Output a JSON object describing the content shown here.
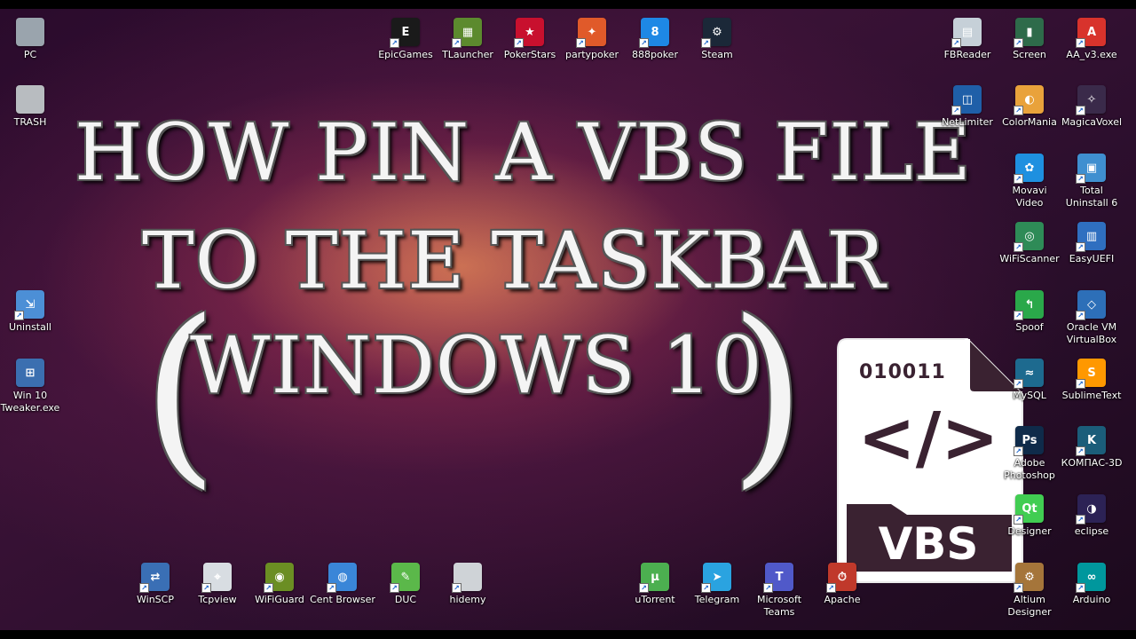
{
  "title": {
    "line1": "HOW PIN A VBS FILE",
    "line2": "TO THE TASKBAR",
    "line3": "WINDOWS 10",
    "paren_open": "(",
    "paren_close": ")"
  },
  "vbs_icon": {
    "binary": "010011",
    "code_symbol": "</>",
    "ext": "VBS"
  },
  "icons": [
    {
      "id": "pc",
      "label": "PC",
      "icon": "monitor-icon",
      "color": "#9aa4ad",
      "glyph": ""
    },
    {
      "id": "trash",
      "label": "TRASH",
      "icon": "recycle-bin-icon",
      "color": "#b8bcc0",
      "glyph": ""
    },
    {
      "id": "uninstall",
      "label": "Uninstall",
      "icon": "uninstall-icon",
      "color": "#4c8fd6",
      "glyph": "⇲"
    },
    {
      "id": "win10tweaker",
      "label": "Win 10\nTweaker.exe",
      "icon": "windows-logo-icon",
      "color": "#3b6fb0",
      "glyph": "⊞"
    },
    {
      "id": "epic",
      "label": "EpicGames",
      "icon": "epic-games-icon",
      "color": "#1a1a1a",
      "glyph": "E"
    },
    {
      "id": "tlauncher",
      "label": "TLauncher",
      "icon": "minecraft-block-icon",
      "color": "#5c8a2e",
      "glyph": "▦"
    },
    {
      "id": "pokerstars",
      "label": "PokerStars",
      "icon": "pokerstars-icon",
      "color": "#c8102e",
      "glyph": "★"
    },
    {
      "id": "partypoker",
      "label": "partypoker",
      "icon": "partypoker-icon",
      "color": "#e05a2a",
      "glyph": "✦"
    },
    {
      "id": "888poker",
      "label": "888poker",
      "icon": "888poker-icon",
      "color": "#1e88e5",
      "glyph": "8"
    },
    {
      "id": "steam",
      "label": "Steam",
      "icon": "steam-icon",
      "color": "#1b2838",
      "glyph": "⚙"
    },
    {
      "id": "fbreader",
      "label": "FBReader",
      "icon": "fbreader-icon",
      "color": "#c6d0d8",
      "glyph": "▤"
    },
    {
      "id": "screen",
      "label": "Screen",
      "icon": "screen-icon",
      "color": "#2e6b4a",
      "glyph": "▮"
    },
    {
      "id": "aa",
      "label": "AA_v3.exe",
      "icon": "ammyy-admin-icon",
      "color": "#d8332c",
      "glyph": "A"
    },
    {
      "id": "netlimiter",
      "label": "NetLimiter",
      "icon": "netlimiter-icon",
      "color": "#1f5fa8",
      "glyph": "◫"
    },
    {
      "id": "colormania",
      "label": "ColorMania",
      "icon": "color-wheel-icon",
      "color": "#e9a23b",
      "glyph": "◐"
    },
    {
      "id": "magicavoxel",
      "label": "MagicaVoxel",
      "icon": "magicavoxel-icon",
      "color": "#3a2a4a",
      "glyph": "✧"
    },
    {
      "id": "movavi",
      "label": "Movavi\nVideo",
      "icon": "movavi-icon",
      "color": "#1e90e0",
      "glyph": "✿"
    },
    {
      "id": "totaluninstall",
      "label": "Total\nUninstall 6",
      "icon": "total-uninstall-icon",
      "color": "#3f8fd0",
      "glyph": "▣"
    },
    {
      "id": "wifiscanner",
      "label": "WiFiScanner",
      "icon": "wifi-scanner-icon",
      "color": "#2e8b57",
      "glyph": "◎"
    },
    {
      "id": "easyuefi",
      "label": "EasyUEFI",
      "icon": "easyuefi-icon",
      "color": "#2f6fc0",
      "glyph": "▥"
    },
    {
      "id": "spoof",
      "label": "Spoof",
      "icon": "spoof-arrow-icon",
      "color": "#2aa84a",
      "glyph": "↰"
    },
    {
      "id": "virtualbox",
      "label": "Oracle VM\nVirtualBox",
      "icon": "virtualbox-icon",
      "color": "#2d6fb8",
      "glyph": "◇"
    },
    {
      "id": "mysql",
      "label": "MySQL",
      "icon": "mysql-dolphin-icon",
      "color": "#1d6a8f",
      "glyph": "≈"
    },
    {
      "id": "sublime",
      "label": "SublimeText",
      "icon": "sublime-text-icon",
      "color": "#ff9800",
      "glyph": "S"
    },
    {
      "id": "photoshop",
      "label": "Adobe\nPhotoshop",
      "icon": "photoshop-icon",
      "color": "#0f2b4a",
      "glyph": "Ps"
    },
    {
      "id": "kompas",
      "label": "КОМПАС-3D",
      "icon": "kompas-3d-icon",
      "color": "#1b5d7a",
      "glyph": "K"
    },
    {
      "id": "qtdesigner",
      "label": "Designer",
      "icon": "qt-designer-icon",
      "color": "#41cd52",
      "glyph": "Qt"
    },
    {
      "id": "eclipse",
      "label": "eclipse",
      "icon": "eclipse-icon",
      "color": "#2c2255",
      "glyph": "◑"
    },
    {
      "id": "altium",
      "label": "Altium\nDesigner",
      "icon": "altium-icon",
      "color": "#a5753a",
      "glyph": "⚙"
    },
    {
      "id": "arduino",
      "label": "Arduino",
      "icon": "arduino-icon",
      "color": "#00979d",
      "glyph": "∞"
    },
    {
      "id": "winscp",
      "label": "WinSCP",
      "icon": "winscp-icon",
      "color": "#3a6fb5",
      "glyph": "⇄"
    },
    {
      "id": "tcpview",
      "label": "Tcpview",
      "icon": "tcpview-icon",
      "color": "#d8dde2",
      "glyph": "⌖"
    },
    {
      "id": "wifiguard",
      "label": "WiFiGuard",
      "icon": "owl-icon",
      "color": "#6b8e23",
      "glyph": "◉"
    },
    {
      "id": "centbrowser",
      "label": "Cent Browser",
      "icon": "cent-browser-icon",
      "color": "#3a86d8",
      "glyph": "◍"
    },
    {
      "id": "duc",
      "label": "DUC",
      "icon": "duc-icon",
      "color": "#5bb84a",
      "glyph": "✎"
    },
    {
      "id": "hidemy",
      "label": "hidemy",
      "icon": "file-icon",
      "color": "#cfd3d7",
      "glyph": ""
    },
    {
      "id": "utorrent",
      "label": "uTorrent",
      "icon": "utorrent-icon",
      "color": "#4caf50",
      "glyph": "µ"
    },
    {
      "id": "telegram",
      "label": "Telegram",
      "icon": "telegram-icon",
      "color": "#2aa3e0",
      "glyph": "➤"
    },
    {
      "id": "teams",
      "label": "Microsoft\nTeams",
      "icon": "microsoft-teams-icon",
      "color": "#5059c9",
      "glyph": "T"
    },
    {
      "id": "apache",
      "label": "Apache",
      "icon": "apache-feather-icon",
      "color": "#c0392b",
      "glyph": "⏱"
    }
  ]
}
